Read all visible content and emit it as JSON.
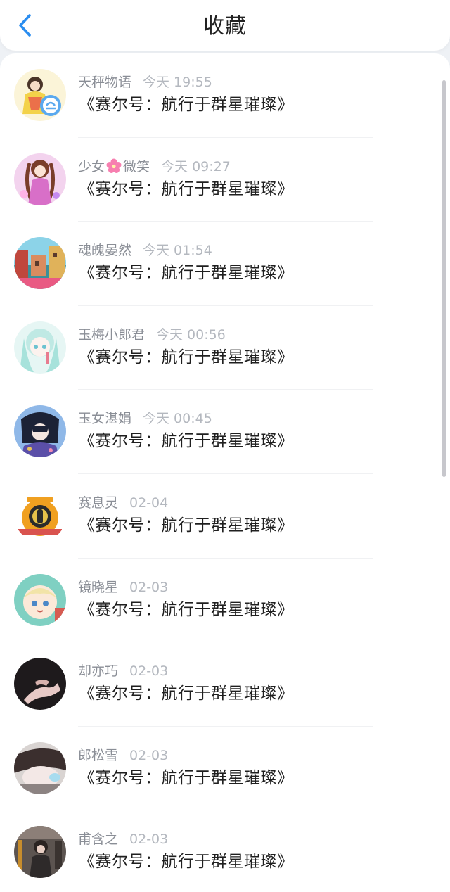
{
  "header": {
    "title": "收藏",
    "back_icon": "chevron-left-icon",
    "accent": "#2a8df0"
  },
  "items": [
    {
      "name": "天秤物语",
      "time": "今天 19:55",
      "title": "《赛尔号：航行于群星璀璨》"
    },
    {
      "name_pre": "少女",
      "name_post": "微笑",
      "name_emoji": "cherry-blossom-icon",
      "time": "今天 09:27",
      "title": "《赛尔号：航行于群星璀璨》"
    },
    {
      "name": "魂魄晏然",
      "time": "今天 01:54",
      "title": "《赛尔号：航行于群星璀璨》"
    },
    {
      "name": "玉梅小郎君",
      "time": "今天 00:56",
      "title": "《赛尔号：航行于群星璀璨》"
    },
    {
      "name": "玉女湛娟",
      "time": "今天 00:45",
      "title": "《赛尔号：航行于群星璀璨》"
    },
    {
      "name": "赛息灵",
      "time": "02-04",
      "title": "《赛尔号：航行于群星璀璨》"
    },
    {
      "name": "镜晓星",
      "time": "02-03",
      "title": "《赛尔号：航行于群星璀璨》"
    },
    {
      "name": "却亦巧",
      "time": "02-03",
      "title": "《赛尔号：航行于群星璀璨》"
    },
    {
      "name": "郎松雪",
      "time": "02-03",
      "title": "《赛尔号：航行于群星璀璨》"
    },
    {
      "name": "甫含之",
      "time": "02-03",
      "title": "《赛尔号：航行于群星璀璨》"
    }
  ]
}
